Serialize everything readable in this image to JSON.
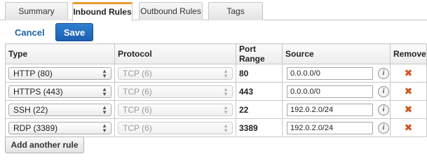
{
  "tabs": [
    {
      "label": "Summary",
      "active": false
    },
    {
      "label": "Inbound Rules",
      "active": true
    },
    {
      "label": "Outbound Rules",
      "active": false
    },
    {
      "label": "Tags",
      "active": false
    }
  ],
  "actions": {
    "cancel_label": "Cancel",
    "save_label": "Save"
  },
  "table": {
    "headers": {
      "type": "Type",
      "protocol": "Protocol",
      "port_range": "Port Range",
      "source": "Source",
      "remove": "Remove"
    },
    "rows": [
      {
        "type": "HTTP (80)",
        "protocol": "TCP (6)",
        "port_range": "80",
        "source": "0.0.0.0/0"
      },
      {
        "type": "HTTPS (443)",
        "protocol": "TCP (6)",
        "port_range": "443",
        "source": "0.0.0.0/0"
      },
      {
        "type": "SSH (22)",
        "protocol": "TCP (6)",
        "port_range": "22",
        "source": "192.0.2.0/24"
      },
      {
        "type": "RDP (3389)",
        "protocol": "TCP (6)",
        "port_range": "3389",
        "source": "192.0.2.0/24"
      }
    ]
  },
  "add_rule_label": "Add another rule",
  "icons": {
    "info": "info-icon",
    "remove": "remove-x-icon",
    "select_arrows": "updown-arrows-icon"
  },
  "colors": {
    "accent_tab": "#e99b2d",
    "link": "#1f64a8",
    "primary_button": "#1b5fb0",
    "remove": "#d2541b"
  }
}
